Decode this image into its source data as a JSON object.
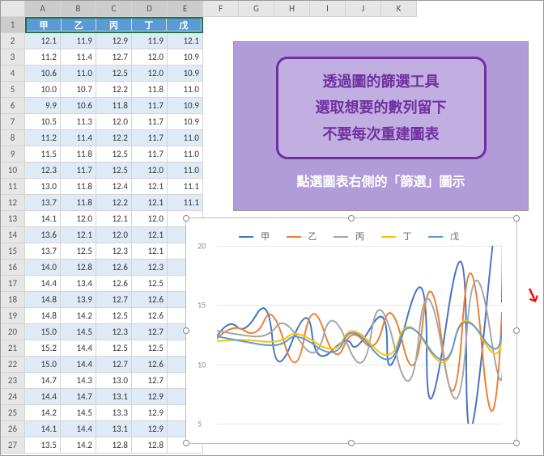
{
  "columns": [
    "A",
    "B",
    "C",
    "D",
    "E",
    "F",
    "G",
    "H",
    "I",
    "J",
    "K"
  ],
  "headers": [
    "甲",
    "乙",
    "丙",
    "丁",
    "戊"
  ],
  "rows": [
    [
      12.1,
      11.9,
      12.9,
      11.9,
      12.1
    ],
    [
      11.2,
      11.4,
      12.7,
      12.0,
      10.9
    ],
    [
      10.6,
      11.0,
      12.5,
      12.0,
      10.9
    ],
    [
      10.0,
      10.7,
      12.2,
      11.8,
      11.0
    ],
    [
      9.9,
      10.6,
      11.8,
      11.7,
      10.9
    ],
    [
      10.5,
      11.3,
      12.0,
      11.7,
      10.9
    ],
    [
      11.2,
      11.4,
      12.2,
      11.7,
      11.0
    ],
    [
      11.5,
      11.8,
      12.5,
      11.7,
      11.0
    ],
    [
      12.3,
      11.7,
      12.5,
      12.0,
      11.0
    ],
    [
      13.0,
      11.8,
      12.4,
      12.1,
      11.1
    ],
    [
      13.7,
      11.8,
      12.2,
      12.1,
      11.1
    ],
    [
      14.1,
      12.0,
      12.1,
      12.0,
      ""
    ],
    [
      13.6,
      12.1,
      12.0,
      12.1,
      ""
    ],
    [
      13.7,
      12.5,
      12.3,
      12.1,
      ""
    ],
    [
      14.0,
      12.8,
      12.6,
      12.3,
      ""
    ],
    [
      14.4,
      13.4,
      12.6,
      12.5,
      ""
    ],
    [
      14.8,
      13.9,
      12.7,
      12.6,
      ""
    ],
    [
      14.8,
      14.2,
      12.5,
      12.6,
      ""
    ],
    [
      15.0,
      14.5,
      12.3,
      12.7,
      ""
    ],
    [
      15.2,
      14.4,
      12.5,
      12.5,
      ""
    ],
    [
      15.0,
      14.4,
      12.7,
      12.6,
      ""
    ],
    [
      14.7,
      14.3,
      13.0,
      12.7,
      ""
    ],
    [
      14.4,
      14.7,
      13.1,
      12.9,
      ""
    ],
    [
      14.2,
      14.5,
      13.3,
      12.9,
      ""
    ],
    [
      14.1,
      14.4,
      13.1,
      12.9,
      ""
    ],
    [
      13.5,
      14.2,
      12.8,
      12.8,
      ""
    ]
  ],
  "note": {
    "l1": "透過圖的篩選工具",
    "l2": "選取想要的數列留下",
    "l3": "不要每次重建圖表",
    "sub": "點選圖表右側的「篩選」圖示"
  },
  "tools": {
    "plus": "+",
    "brush": "🖌",
    "filter": "▼"
  },
  "chart_data": {
    "type": "line",
    "series": [
      {
        "name": "甲",
        "color": "#4472c4"
      },
      {
        "name": "乙",
        "color": "#ed7d31"
      },
      {
        "name": "丙",
        "color": "#a5a5a5"
      },
      {
        "name": "丁",
        "color": "#ffc000"
      },
      {
        "name": "戊",
        "color": "#5b9bd5"
      }
    ],
    "ylim": [
      5,
      20
    ],
    "yticks": [
      5,
      10,
      15,
      20
    ],
    "xlabel": "",
    "ylabel": "",
    "title": ""
  }
}
